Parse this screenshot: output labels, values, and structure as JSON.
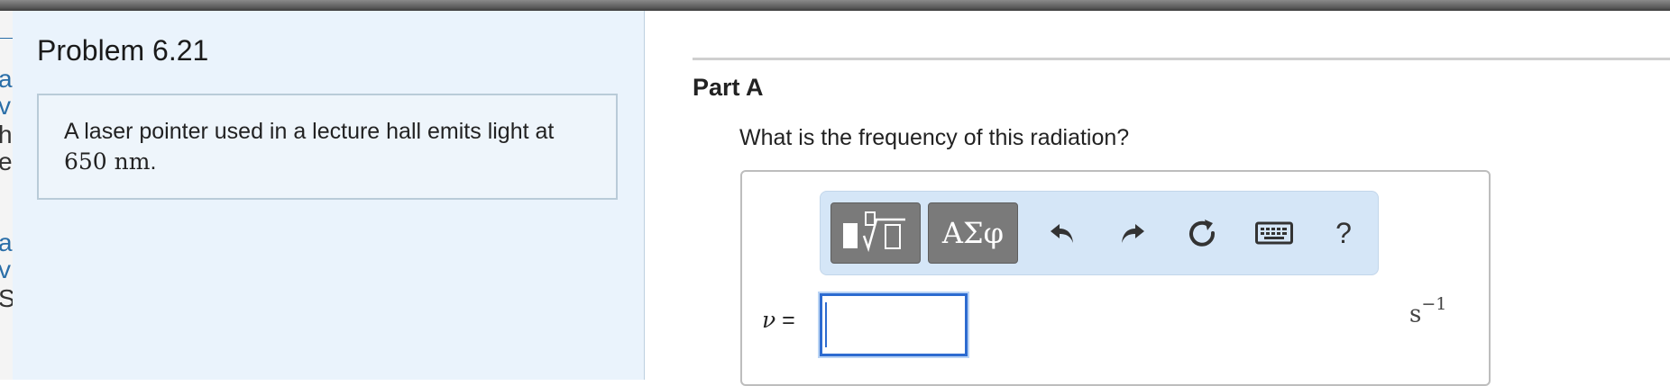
{
  "left_edge_fragments": [
    "at",
    "v",
    "ha",
    "e",
    "at",
    "v",
    "S"
  ],
  "problem": {
    "title": "Problem 6.21",
    "statement_text": "A laser pointer used in a lecture hall emits light at",
    "statement_value": "650 nm",
    "statement_end": "."
  },
  "part": {
    "label": "Part A",
    "question": "What is the frequency of this radiation?",
    "toolbar": {
      "greek_label": "ΑΣφ",
      "help_label": "?",
      "icons": [
        "templates-icon",
        "undo-icon",
        "redo-icon",
        "reset-icon",
        "keyboard-icon",
        "help-icon"
      ]
    },
    "answer": {
      "variable": "ν",
      "equals": "=",
      "value": "",
      "unit_base": "s",
      "unit_exp": "−1"
    }
  },
  "colors": {
    "accent": "#2d6bd0",
    "problem_bg": "#eaf3fc",
    "toolbar_bg": "#d5e6f7",
    "button_gray": "#7a7a7a",
    "link_blue": "#2a6ea8"
  }
}
